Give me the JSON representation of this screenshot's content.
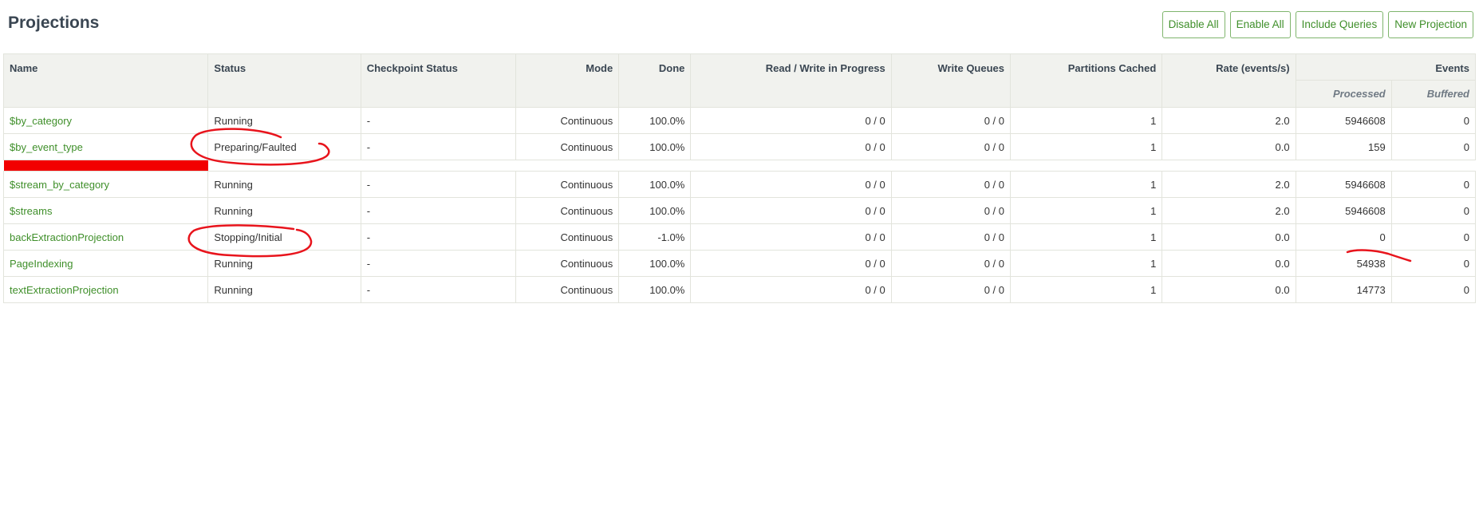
{
  "page_title": "Projections",
  "toolbar": {
    "disable_all": "Disable All",
    "enable_all": "Enable All",
    "include_queries": "Include Queries",
    "new_projection": "New Projection"
  },
  "table": {
    "headers": {
      "name": "Name",
      "status": "Status",
      "checkpoint_status": "Checkpoint Status",
      "mode": "Mode",
      "done": "Done",
      "read_write": "Read / Write in Progress",
      "write_queues": "Write Queues",
      "partitions_cached": "Partitions Cached",
      "rate": "Rate (events/s)",
      "events": "Events",
      "processed": "Processed",
      "buffered": "Buffered"
    },
    "rows": [
      {
        "name": "$by_category",
        "status": "Running",
        "checkpoint": "-",
        "mode": "Continuous",
        "done": "100.0%",
        "rw": "0 / 0",
        "wq": "0 / 0",
        "partitions": "1",
        "rate": "2.0",
        "processed": "5946608",
        "buffered": "0"
      },
      {
        "name": "$by_event_type",
        "status": "Preparing/Faulted",
        "checkpoint": "-",
        "mode": "Continuous",
        "done": "100.0%",
        "rw": "0 / 0",
        "wq": "0 / 0",
        "partitions": "1",
        "rate": "0.0",
        "processed": "159",
        "buffered": "0"
      },
      {
        "name": "$stream_by_category",
        "status": "Running",
        "checkpoint": "-",
        "mode": "Continuous",
        "done": "100.0%",
        "rw": "0 / 0",
        "wq": "0 / 0",
        "partitions": "1",
        "rate": "2.0",
        "processed": "5946608",
        "buffered": "0"
      },
      {
        "name": "$streams",
        "status": "Running",
        "checkpoint": "-",
        "mode": "Continuous",
        "done": "100.0%",
        "rw": "0 / 0",
        "wq": "0 / 0",
        "partitions": "1",
        "rate": "2.0",
        "processed": "5946608",
        "buffered": "0"
      },
      {
        "name": "backExtractionProjection",
        "status": "Stopping/Initial",
        "checkpoint": "-",
        "mode": "Continuous",
        "done": "-1.0%",
        "rw": "0 / 0",
        "wq": "0 / 0",
        "partitions": "1",
        "rate": "0.0",
        "processed": "0",
        "buffered": "0"
      },
      {
        "name": "PageIndexing",
        "status": "Running",
        "checkpoint": "-",
        "mode": "Continuous",
        "done": "100.0%",
        "rw": "0 / 0",
        "wq": "0 / 0",
        "partitions": "1",
        "rate": "0.0",
        "processed": "54938",
        "buffered": "0"
      },
      {
        "name": "textExtractionProjection",
        "status": "Running",
        "checkpoint": "-",
        "mode": "Continuous",
        "done": "100.0%",
        "rw": "0 / 0",
        "wq": "0 / 0",
        "partitions": "1",
        "rate": "0.0",
        "processed": "14773",
        "buffered": "0"
      }
    ]
  },
  "annotation_color": "#e8141c",
  "accent_green": "#3f8f2a"
}
